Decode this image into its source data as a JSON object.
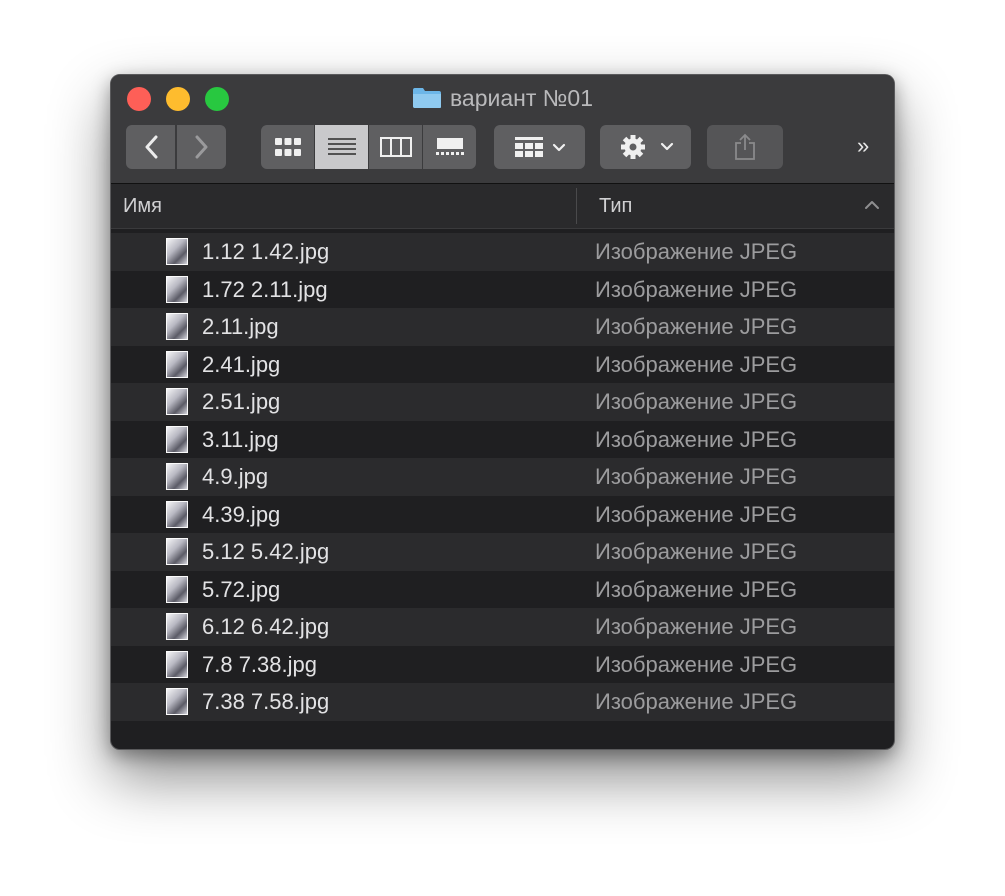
{
  "window": {
    "title": "вариант №01"
  },
  "toolbar": {
    "icons": {
      "back": "chevron-left-icon",
      "forward": "chevron-right-icon",
      "icon_view": "grid-icon",
      "list_view": "list-icon",
      "column_view": "columns-icon",
      "gallery_view": "gallery-icon",
      "group": "group-icon",
      "action": "gear-icon",
      "share": "share-icon",
      "more": "more-icon"
    },
    "more_label": "»"
  },
  "columns": {
    "name": "Имя",
    "kind": "Тип"
  },
  "files": [
    {
      "name": "1.12 1.42.jpg",
      "kind": "Изображение JPEG"
    },
    {
      "name": "1.72 2.11.jpg",
      "kind": "Изображение JPEG"
    },
    {
      "name": "2.11.jpg",
      "kind": "Изображение JPEG"
    },
    {
      "name": "2.41.jpg",
      "kind": "Изображение JPEG"
    },
    {
      "name": "2.51.jpg",
      "kind": "Изображение JPEG"
    },
    {
      "name": "3.11.jpg",
      "kind": "Изображение JPEG"
    },
    {
      "name": "4.9.jpg",
      "kind": "Изображение JPEG"
    },
    {
      "name": "4.39.jpg",
      "kind": "Изображение JPEG"
    },
    {
      "name": "5.12 5.42.jpg",
      "kind": "Изображение JPEG"
    },
    {
      "name": "5.72.jpg",
      "kind": "Изображение JPEG"
    },
    {
      "name": "6.12 6.42.jpg",
      "kind": "Изображение JPEG"
    },
    {
      "name": "7.8 7.38.jpg",
      "kind": "Изображение JPEG"
    },
    {
      "name": "7.38 7.58.jpg",
      "kind": "Изображение JPEG"
    }
  ],
  "colors": {
    "close": "#fe5f57",
    "minimize": "#febc2e",
    "maximize": "#28c840",
    "folder": "#6cb6e8"
  }
}
